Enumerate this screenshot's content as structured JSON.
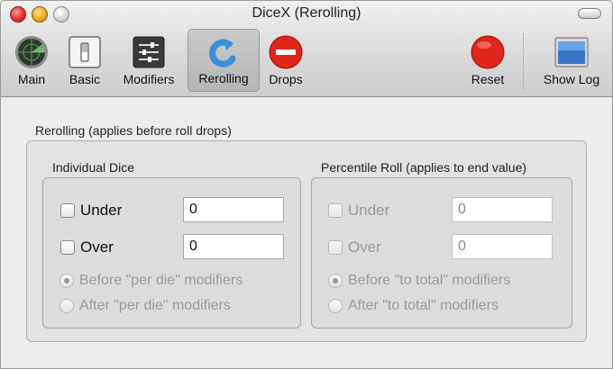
{
  "window": {
    "title": "DiceX (Rerolling)"
  },
  "toolbar": {
    "main": "Main",
    "basic": "Basic",
    "modifiers": "Modifiers",
    "rerolling": "Rerolling",
    "drops": "Drops",
    "reset": "Reset",
    "show_log": "Show Log"
  },
  "section": {
    "title": "Rerolling (applies before roll drops)"
  },
  "individual": {
    "title": "Individual Dice",
    "under_label": "Under",
    "under_value": "0",
    "over_label": "Over",
    "over_value": "0",
    "radio_before": "Before \"per die\" modifiers",
    "radio_after": "After \"per die\" modifiers"
  },
  "percentile": {
    "title": "Percentile Roll (applies to end value)",
    "under_label": "Under",
    "under_value": "0",
    "over_label": "Over",
    "over_value": "0",
    "radio_before": "Before \"to total\" modifiers",
    "radio_after": "After \"to total\" modifiers"
  },
  "colors": {
    "accent_blue": "#3a8fd8",
    "red": "#e0251c",
    "active_tab": "#bdbdbd"
  }
}
